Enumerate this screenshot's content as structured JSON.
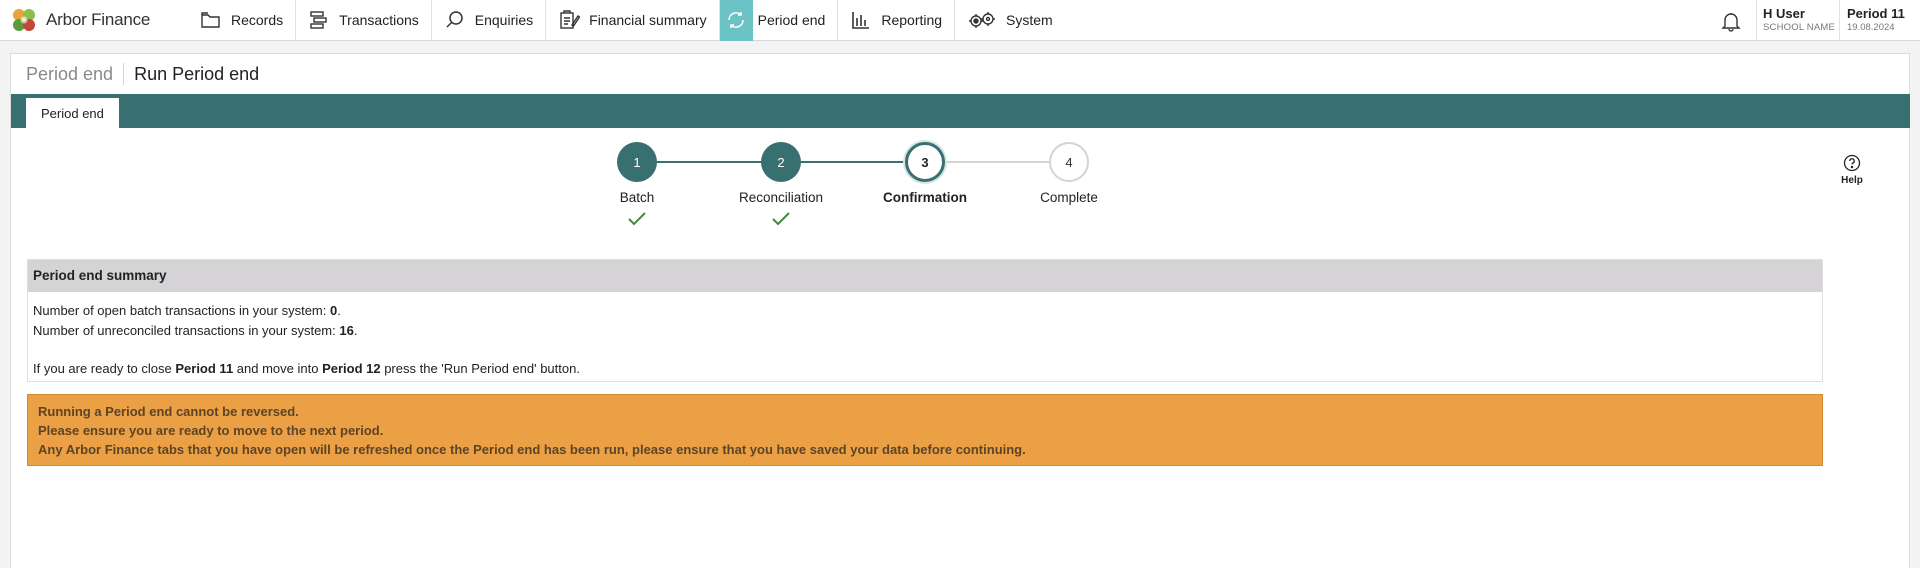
{
  "app": {
    "name": "Arbor Finance"
  },
  "nav": {
    "items": [
      {
        "label": "Records",
        "icon": "folder-icon"
      },
      {
        "label": "Transactions",
        "icon": "transactions-icon"
      },
      {
        "label": "Enquiries",
        "icon": "search-icon"
      },
      {
        "label": "Financial summary",
        "icon": "clipboard-icon"
      },
      {
        "label": "Period end",
        "icon": "refresh-icon",
        "active": true
      },
      {
        "label": "Reporting",
        "icon": "bar-chart-icon"
      },
      {
        "label": "System",
        "icon": "gears-icon"
      }
    ]
  },
  "user": {
    "name": "H User",
    "school": "SCHOOL NAME"
  },
  "period": {
    "label": "Period 11",
    "date": "19.08.2024"
  },
  "page": {
    "breadcrumb_parent": "Period end",
    "title": "Run Period end"
  },
  "tabs": [
    {
      "label": "Period end",
      "active": true
    }
  ],
  "stepper": {
    "steps": [
      {
        "number": "1",
        "label": "Batch",
        "state": "done"
      },
      {
        "number": "2",
        "label": "Reconciliation",
        "state": "done"
      },
      {
        "number": "3",
        "label": "Confirmation",
        "state": "current"
      },
      {
        "number": "4",
        "label": "Complete",
        "state": "todo"
      }
    ]
  },
  "help": {
    "label": "Help"
  },
  "summary": {
    "title": "Period end summary",
    "open_batch_prefix": "Number of open batch transactions in your system: ",
    "open_batch_count": "0",
    "unreconciled_prefix": "Number of unreconciled transactions in your system: ",
    "unreconciled_count": "16",
    "period_sentence_1": "If you are ready to close ",
    "current_period": "Period 11",
    "period_sentence_2": " and move into ",
    "next_period": "Period 12",
    "period_sentence_3": " press the 'Run Period end' button."
  },
  "warning": {
    "lines": [
      "Running a Period end cannot be reversed.",
      "Please ensure you are ready to move to the next period.",
      "Any Arbor Finance tabs that you have open will be refreshed once the Period end has been run, please ensure that you have saved your data before continuing."
    ]
  },
  "colors": {
    "accent": "#386f70",
    "active_nav": "#6cc3c5",
    "warning": "#eba046",
    "summary_header": "#d5d3d6"
  }
}
